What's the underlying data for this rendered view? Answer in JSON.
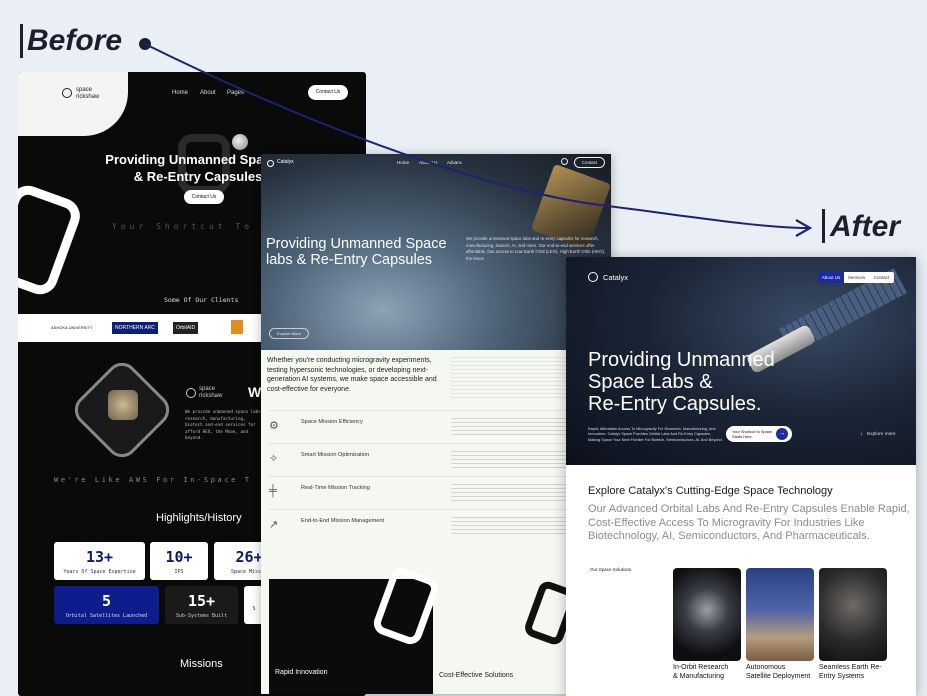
{
  "labels": {
    "before": "Before",
    "after": "After"
  },
  "before": {
    "logo_text": "space rickshaw",
    "nav": [
      "Home",
      "About",
      "Pages"
    ],
    "contact": "Contact Us",
    "hero_title_line1": "Providing Unmanned Spac",
    "hero_title_line2": "& Re-Entry Capsules",
    "hero_button": "Contact Us",
    "tagline": "Your Shortcut To",
    "clients_heading": "Some Of Our Clients",
    "clients": [
      "ASHOKA UNIVERSITY",
      "NORTHERN ARC",
      "OrbitAID",
      ""
    ],
    "about_logo": "space rickshaw",
    "about_heading_partial": "W",
    "about_text": "We provide unmanned space labs research, manufacturing, biotech and-end services for afford HEO, the Moon, and beyond.",
    "aws_line": "We're Like AWS For In-Space T",
    "highlights_heading": "Highlights/History",
    "stats": [
      {
        "num": "13+",
        "label": "Years Of Space Expertise"
      },
      {
        "num": "10+",
        "label": "IPS"
      },
      {
        "num": "26+",
        "label": "Space Missio"
      },
      {
        "num": "5",
        "label": "Orbital Satellites Launched"
      },
      {
        "num": "15+",
        "label": "Sub-Systems Built"
      },
      {
        "num": "",
        "label": "S"
      }
    ],
    "missions_heading": "Missions"
  },
  "middle": {
    "logo": "Catalyx",
    "nav": [
      "Home",
      "About Us",
      "Advanc"
    ],
    "contact": "Contact",
    "hero_title": "Providing Unmanned Space labs & Re-Entry Capsules",
    "hero_desc": "We provide unmanned space labs and re-entry capsules for research, manufacturing, biotech, AI, and more. Our end-to-end services offer affordable, fast access to Low Earth Orbit (LEO), High Earth Orbit (HEO), the Moon",
    "hero_button": "Explore More",
    "intro": "Whether you're conducting microgravity experiments, testing hypersonic technologies, or developing next-generation AI systems, we make space accessible and cost-effective for everyone.",
    "features": [
      "Space Mission Efficiency",
      "Smart Mission Optimization",
      "Real-Time Mission Tracking",
      "End-to-End Mission Management"
    ],
    "bottom_left": "Rapid Innovation",
    "bottom_right": "Cost-Effective Solutions"
  },
  "after": {
    "logo": "Catalyx",
    "nav": [
      "About Us",
      "Services",
      "Contact"
    ],
    "hero_title_1": "Providing Unmanned",
    "hero_title_2": "Space Labs &",
    "hero_title_3": "Re-Entry Capsules.",
    "hero_desc": "Rapid, Affordable Access To Microgravity For Research, Manufacturing, And Innovation. Catalyx Space Provides Orbital Labs And Re-Entry Capsules, Making Space Your Next Frontier For Biotech, Semiconductors, AI, And Beyond.",
    "cta": "Your Shortcut to Space Starts Here.",
    "explore": "Explore more",
    "section_title": "Explore Catalyx's Cutting-Edge Space Technology",
    "section_sub": "Our Advanced Orbital Labs And Re-Entry Capsules Enable Rapid, Cost-Effective Access To Microgravity For Industries Like Biotechnology, AI, Semiconductors, And Pharmaceuticals.",
    "solutions_label": "Our Space Solutions",
    "cards": [
      {
        "label1": "In-Orbit Research",
        "label2": "& Manufacturing"
      },
      {
        "label1": "Autonomous",
        "label2": "Satellite Deployment"
      },
      {
        "label1": "Seamless Earth Re-",
        "label2": "Entry Systems"
      }
    ]
  }
}
